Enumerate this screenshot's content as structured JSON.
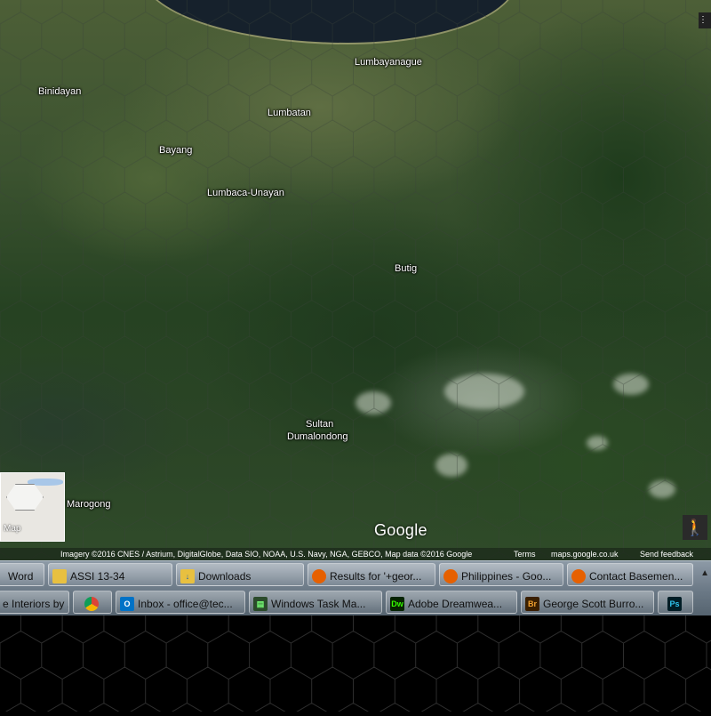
{
  "map": {
    "places": [
      {
        "name": "Lumbayanague"
      },
      {
        "name": "Binidayan"
      },
      {
        "name": "Lumbatan"
      },
      {
        "name": "Bayang"
      },
      {
        "name": "Lumbaca-Unayan"
      },
      {
        "name": "Butig"
      },
      {
        "name": "Sultan"
      },
      {
        "name": "Dumalondong"
      },
      {
        "name": "Marogong"
      }
    ],
    "logo": "Google",
    "minimap_label": "Map",
    "attribution": {
      "imagery": "Imagery ©2016 CNES / Astrium, DigitalGlobe, Data SIO, NOAA, U.S. Navy, NGA, GEBCO, Map data ©2016 Google",
      "terms": "Terms",
      "domain": "maps.google.co.uk",
      "feedback": "Send feedback"
    },
    "pegman_icon": "pegman-icon",
    "apps_icon": "grid-icon"
  },
  "taskbar": {
    "row1": [
      {
        "label": "Word",
        "icon": "word-icon"
      },
      {
        "label": "ASSI 13-34",
        "icon": "folder-icon"
      },
      {
        "label": "Downloads",
        "icon": "folder-download-icon"
      },
      {
        "label": "Results for '+geor...",
        "icon": "firefox-icon"
      },
      {
        "label": "Philippines - Goo...",
        "icon": "firefox-icon"
      },
      {
        "label": "Contact Basemen...",
        "icon": "firefox-icon"
      }
    ],
    "row2": [
      {
        "label": "e Interiors by ...",
        "icon": ""
      },
      {
        "label": "",
        "icon": "chrome-icon"
      },
      {
        "label": "Inbox - office@tec...",
        "icon": "outlook-icon"
      },
      {
        "label": "Windows Task Ma...",
        "icon": "task-manager-icon"
      },
      {
        "label": "Adobe Dreamwea...",
        "icon": "dreamweaver-icon"
      },
      {
        "label": "George Scott Burro...",
        "icon": "bridge-icon"
      },
      {
        "label": "",
        "icon": "photoshop-icon"
      }
    ],
    "scroll_icon": "scroll-up-icon"
  },
  "colors": {
    "firefox": "#e66000",
    "dreamweaver": "#35fa00",
    "outlook": "#0072c6",
    "photoshop": "#31c5f0"
  }
}
